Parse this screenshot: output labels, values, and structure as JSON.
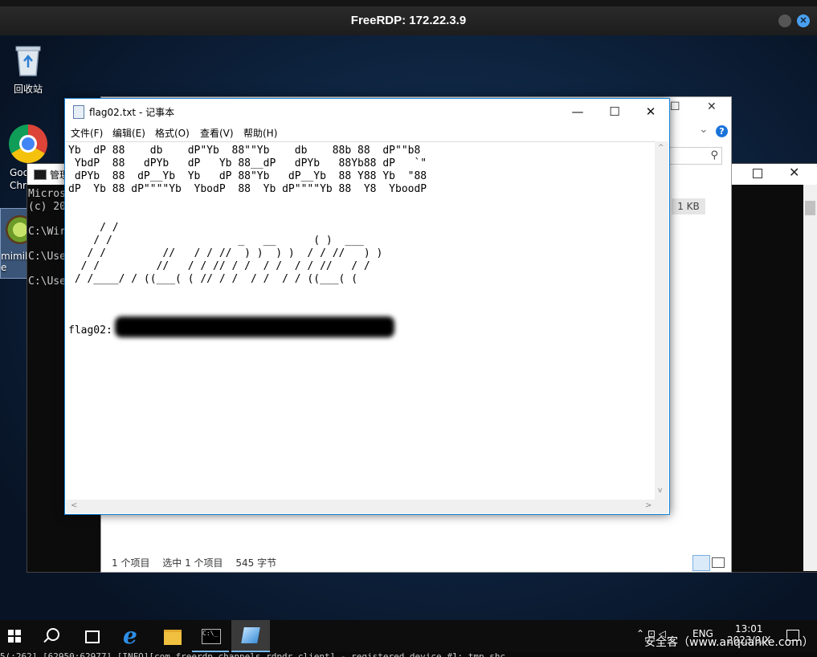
{
  "rdp": {
    "title": "FreeRDP: 172.22.3.9",
    "close_glyph": "✕"
  },
  "desktop": {
    "recycle_bin_label": "回收站",
    "chrome_label": "Goo\nChro",
    "mimikatz_label": "mimik\ne"
  },
  "cmd": {
    "title": "管理",
    "text_lines": "Micros\n(c) 20\n\nC:\\Wir\n\nC:\\Use\n\nC:\\Use",
    "close_glyph": "✕"
  },
  "explorer": {
    "min_glyph": "—",
    "max_glyph": "☐",
    "close_glyph": "✕",
    "chevron_glyph": "⌄",
    "help_glyph": "?",
    "search_glyph": "⚲",
    "size_label": "1 KB",
    "status": {
      "items": "1 个项目",
      "selected": "选中 1 个项目",
      "bytes": "545 字节"
    }
  },
  "notepad": {
    "title": "flag02.txt - 记事本",
    "min_glyph": "—",
    "max_glyph": "☐",
    "close_glyph": "✕",
    "menu": [
      "文件(F)",
      "编辑(E)",
      "格式(O)",
      "查看(V)",
      "帮助(H)"
    ],
    "content": "Yb  dP 88    db    dP\"Yb  88\"\"Yb    db    88b 88  dP\"\"b8\n YbdP  88   dPYb   dP   Yb 88__dP   dPYb   88Yb88 dP   `\"\n dPYb  88  dP__Yb  Yb   dP 88\"Yb   dP__Yb  88 Y88 Yb  \"88\ndP  Yb 88 dP\"\"\"\"Yb  YbodP  88  Yb dP\"\"\"\"Yb 88  Y8  YboodP\n\n\n     / /\n    / /                    _   __      ( )  ___\n   / /         //   / / //  ) )  ) )  / / //   ) )\n  / /         //   / / // / /  / /  / / //   / /\n / /____/ / ((___( ( // / /  / /  / / ((___( (\n\n\n\nflag02:",
    "scroll_up": "^",
    "scroll_down": "v",
    "scroll_left": "<",
    "scroll_right": ">"
  },
  "taskbar": {
    "ie_glyph": "e",
    "cmd_glyph": "C:\\_",
    "lang": "ENG",
    "time": "13:01",
    "date": "2023/9/X",
    "tray_icons": "⌃  ⊡  ◁"
  },
  "watermark": "安全客（www.anquanke.com）",
  "log_text": "5(:262] [62950:62977] [INFO][com.freerdp.channels.rdpdr.client] - registered device #1: tmp_shc"
}
